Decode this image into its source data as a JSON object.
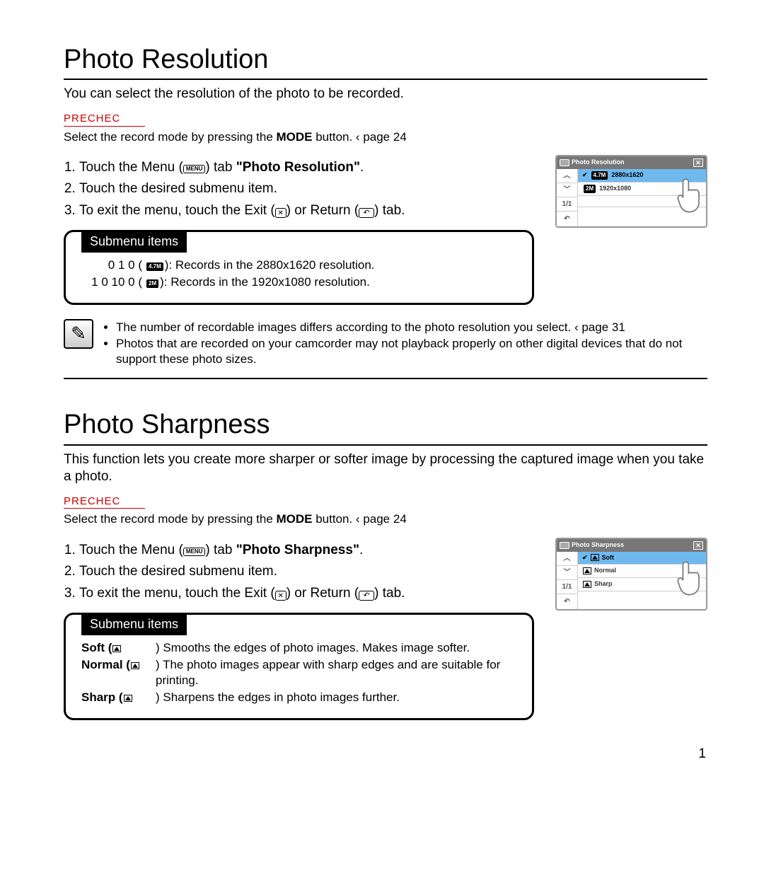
{
  "page_number": "1",
  "sections": {
    "resolution": {
      "title": "Photo Resolution",
      "intro": "You can select the resolution of the photo to be recorded.",
      "precheck_label": "PRECHEC",
      "precheck_pre": "Select the record mode by pressing the ",
      "precheck_mode": "MODE",
      "precheck_post": " button.  ‹ page 24",
      "step1_a": "Touch the Menu (",
      "step1_menu": "MENU",
      "step1_b": ") tab    ",
      "step1_name": "\"Photo Resolution\"",
      "step1_c": ".",
      "step2": "Touch the desired submenu item.",
      "step3_a": "To exit the menu, touch the Exit (",
      "step3_b": ") or Return (",
      "step3_c": ") tab.",
      "exit_glyph": "✕",
      "return_glyph": "↶",
      "submenu_tab": "Submenu items",
      "submenu": {
        "r1_label": "0 1  0 (",
        "r1_chip": "4.7M",
        "r1_text": "): Records in the 2880x1620 resolution.",
        "r2_label": "1  0 10 0 (",
        "r2_chip": "2M",
        "r2_text": "): Records in the 1920x1080 resolution."
      },
      "note_bullet1": "The number of recordable images differs according to the photo resolution you select.  ‹ page 31",
      "note_bullet2": "Photos that are recorded on your camcorder may not playback properly on other digital devices that do not support these photo sizes."
    },
    "sharpness": {
      "title": "Photo Sharpness",
      "intro": "This function lets you create more sharper or softer image by processing the captured image when you take a photo.",
      "precheck_label": "PRECHEC",
      "precheck_pre": "Select the record mode by pressing the ",
      "precheck_mode": "MODE",
      "precheck_post": " button.  ‹ page 24",
      "step1_a": "Touch the Menu (",
      "step1_menu": "MENU",
      "step1_b": ") tab    ",
      "step1_name": "\"Photo Sharpness\"",
      "step1_c": ".",
      "step2": "Touch the desired submenu item.",
      "step3_a": "To exit the menu, touch the Exit (",
      "step3_b": ") or Return (",
      "step3_c": ") tab.",
      "exit_glyph": "✕",
      "return_glyph": "↶",
      "submenu_tab": "Submenu items",
      "submenu": {
        "r1_label": "Soft (",
        "r1_text": ")   Smooths the edges of photo images. Makes image softer.",
        "r2_label": "Normal (",
        "r2_text": ")   The photo images appear with sharp edges and are suitable for printing.",
        "r3_label": "Sharp (",
        "r3_text": ")   Sharpens the edges in photo images further."
      }
    }
  },
  "device_resolution": {
    "title": "Photo Resolution",
    "close": "✕",
    "up": "︿",
    "down": "﹀",
    "page": "1/1",
    "return": "↶",
    "rows": [
      {
        "chip": "4.7M",
        "label": "2880x1620",
        "selected": true
      },
      {
        "chip": "2M",
        "label": "1920x1080",
        "selected": false
      }
    ]
  },
  "device_sharpness": {
    "title": "Photo Sharpness",
    "close": "✕",
    "up": "︿",
    "down": "﹀",
    "page": "1/1",
    "return": "↶",
    "rows": [
      {
        "label": "Soft",
        "selected": true
      },
      {
        "label": "Normal",
        "selected": false
      },
      {
        "label": "Sharp",
        "selected": false
      }
    ]
  }
}
